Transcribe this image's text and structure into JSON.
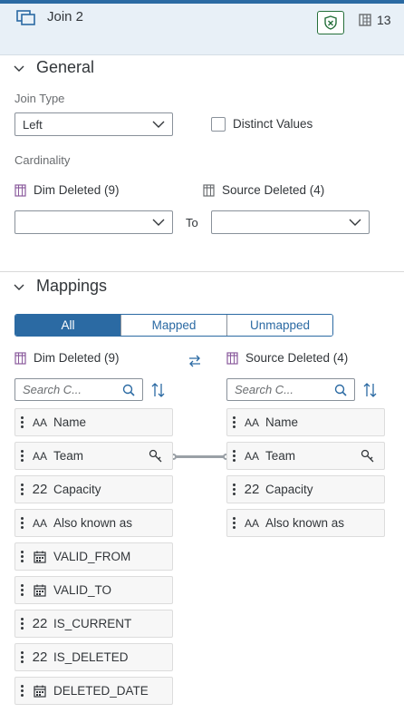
{
  "header": {
    "title": "Join 2",
    "count": "13"
  },
  "general": {
    "title": "General",
    "join_type_label": "Join Type",
    "join_type_value": "Left",
    "distinct_label": "Distinct Values",
    "cardinality_label": "Cardinality",
    "left_entity": "Dim Deleted (9)",
    "right_entity": "Source Deleted (4)",
    "to_label": "To",
    "left_cardinality_value": "",
    "right_cardinality_value": ""
  },
  "mappings": {
    "title": "Mappings",
    "tabs": [
      "All",
      "Mapped",
      "Unmapped"
    ],
    "selected_tab": "All",
    "left_entity": "Dim Deleted (9)",
    "right_entity": "Source Deleted (4)",
    "search_placeholder": "Search C...",
    "left_fields": [
      {
        "name": "Name",
        "type": "string"
      },
      {
        "name": "Team",
        "type": "string",
        "key": true
      },
      {
        "name": "Capacity",
        "type": "number"
      },
      {
        "name": "Also known as",
        "type": "string"
      },
      {
        "name": "VALID_FROM",
        "type": "date"
      },
      {
        "name": "VALID_TO",
        "type": "date"
      },
      {
        "name": "IS_CURRENT",
        "type": "number"
      },
      {
        "name": "IS_DELETED",
        "type": "number"
      },
      {
        "name": "DELETED_DATE",
        "type": "date"
      }
    ],
    "right_fields": [
      {
        "name": "Name",
        "type": "string"
      },
      {
        "name": "Team",
        "type": "string",
        "key": true
      },
      {
        "name": "Capacity",
        "type": "number"
      },
      {
        "name": "Also known as",
        "type": "string"
      }
    ],
    "type_glyphs": {
      "string": "AA",
      "number": "22"
    }
  },
  "colors": {
    "accent": "#2b6aa3",
    "shield": "#256f3a"
  }
}
